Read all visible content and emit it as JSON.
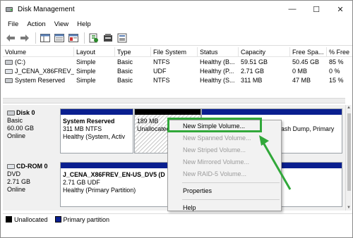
{
  "window": {
    "title": "Disk Management",
    "controls": {
      "minimize": "—",
      "maximize": "☐",
      "close": "✕"
    }
  },
  "menu": [
    "File",
    "Action",
    "View",
    "Help"
  ],
  "toolbar_icons": [
    "back-arrow-icon",
    "forward-arrow-icon",
    "console-tree-icon",
    "help-pane-icon",
    "properties-icon",
    "help-icon",
    "refresh-icon",
    "rescan-icon"
  ],
  "volume_list": {
    "columns": [
      "Volume",
      "Layout",
      "Type",
      "File System",
      "Status",
      "Capacity",
      "Free Spa...",
      "% Free"
    ],
    "rows": [
      {
        "volume": "(C:)",
        "layout": "Simple",
        "type": "Basic",
        "fs": "NTFS",
        "status": "Healthy (B...",
        "capacity": "59.51 GB",
        "free": "50.45 GB",
        "pct": "85 %"
      },
      {
        "volume": "J_CENA_X86FREV_...",
        "layout": "Simple",
        "type": "Basic",
        "fs": "UDF",
        "status": "Healthy (P...",
        "capacity": "2.71 GB",
        "free": "0 MB",
        "pct": "0 %"
      },
      {
        "volume": "System Reserved",
        "layout": "Simple",
        "type": "Basic",
        "fs": "NTFS",
        "status": "Healthy (S...",
        "capacity": "311 MB",
        "free": "47 MB",
        "pct": "15 %"
      }
    ]
  },
  "disks": [
    {
      "name": "Disk 0",
      "type": "Basic",
      "size": "60.00 GB",
      "state": "Online",
      "partitions": [
        {
          "name": "System Reserved",
          "line1": "311 MB NTFS",
          "line2": "Healthy (System, Activ"
        },
        {
          "name": "",
          "line1": "189 MB",
          "line2": "Unallocated"
        },
        {
          "name": "",
          "line1": "",
          "line2": "ash Dump, Primary"
        }
      ]
    },
    {
      "name": "CD-ROM 0",
      "type": "DVD",
      "size": "2.71 GB",
      "state": "Online",
      "partitions": [
        {
          "name": "J_CENA_X86FREV_EN-US_DV5  (D",
          "line1": "2.71 GB UDF",
          "line2": "Healthy (Primary Partition)"
        }
      ]
    }
  ],
  "context_menu": {
    "items": [
      {
        "label": "New Simple Volume...",
        "disabled": false
      },
      {
        "label": "New Spanned Volume...",
        "disabled": true
      },
      {
        "label": "New Striped Volume...",
        "disabled": true
      },
      {
        "label": "New Mirrored Volume...",
        "disabled": true
      },
      {
        "label": "New RAID-5 Volume...",
        "disabled": true
      },
      {
        "label": "Properties",
        "disabled": false
      },
      {
        "label": "Help",
        "disabled": false
      }
    ]
  },
  "legend": [
    {
      "label": "Unallocated",
      "color": "#000000"
    },
    {
      "label": "Primary partition",
      "color": "#0a1f8f"
    }
  ],
  "colors": {
    "primary_partition": "#0a1f8f",
    "unallocated": "#000000",
    "highlight": "#31a83a"
  }
}
